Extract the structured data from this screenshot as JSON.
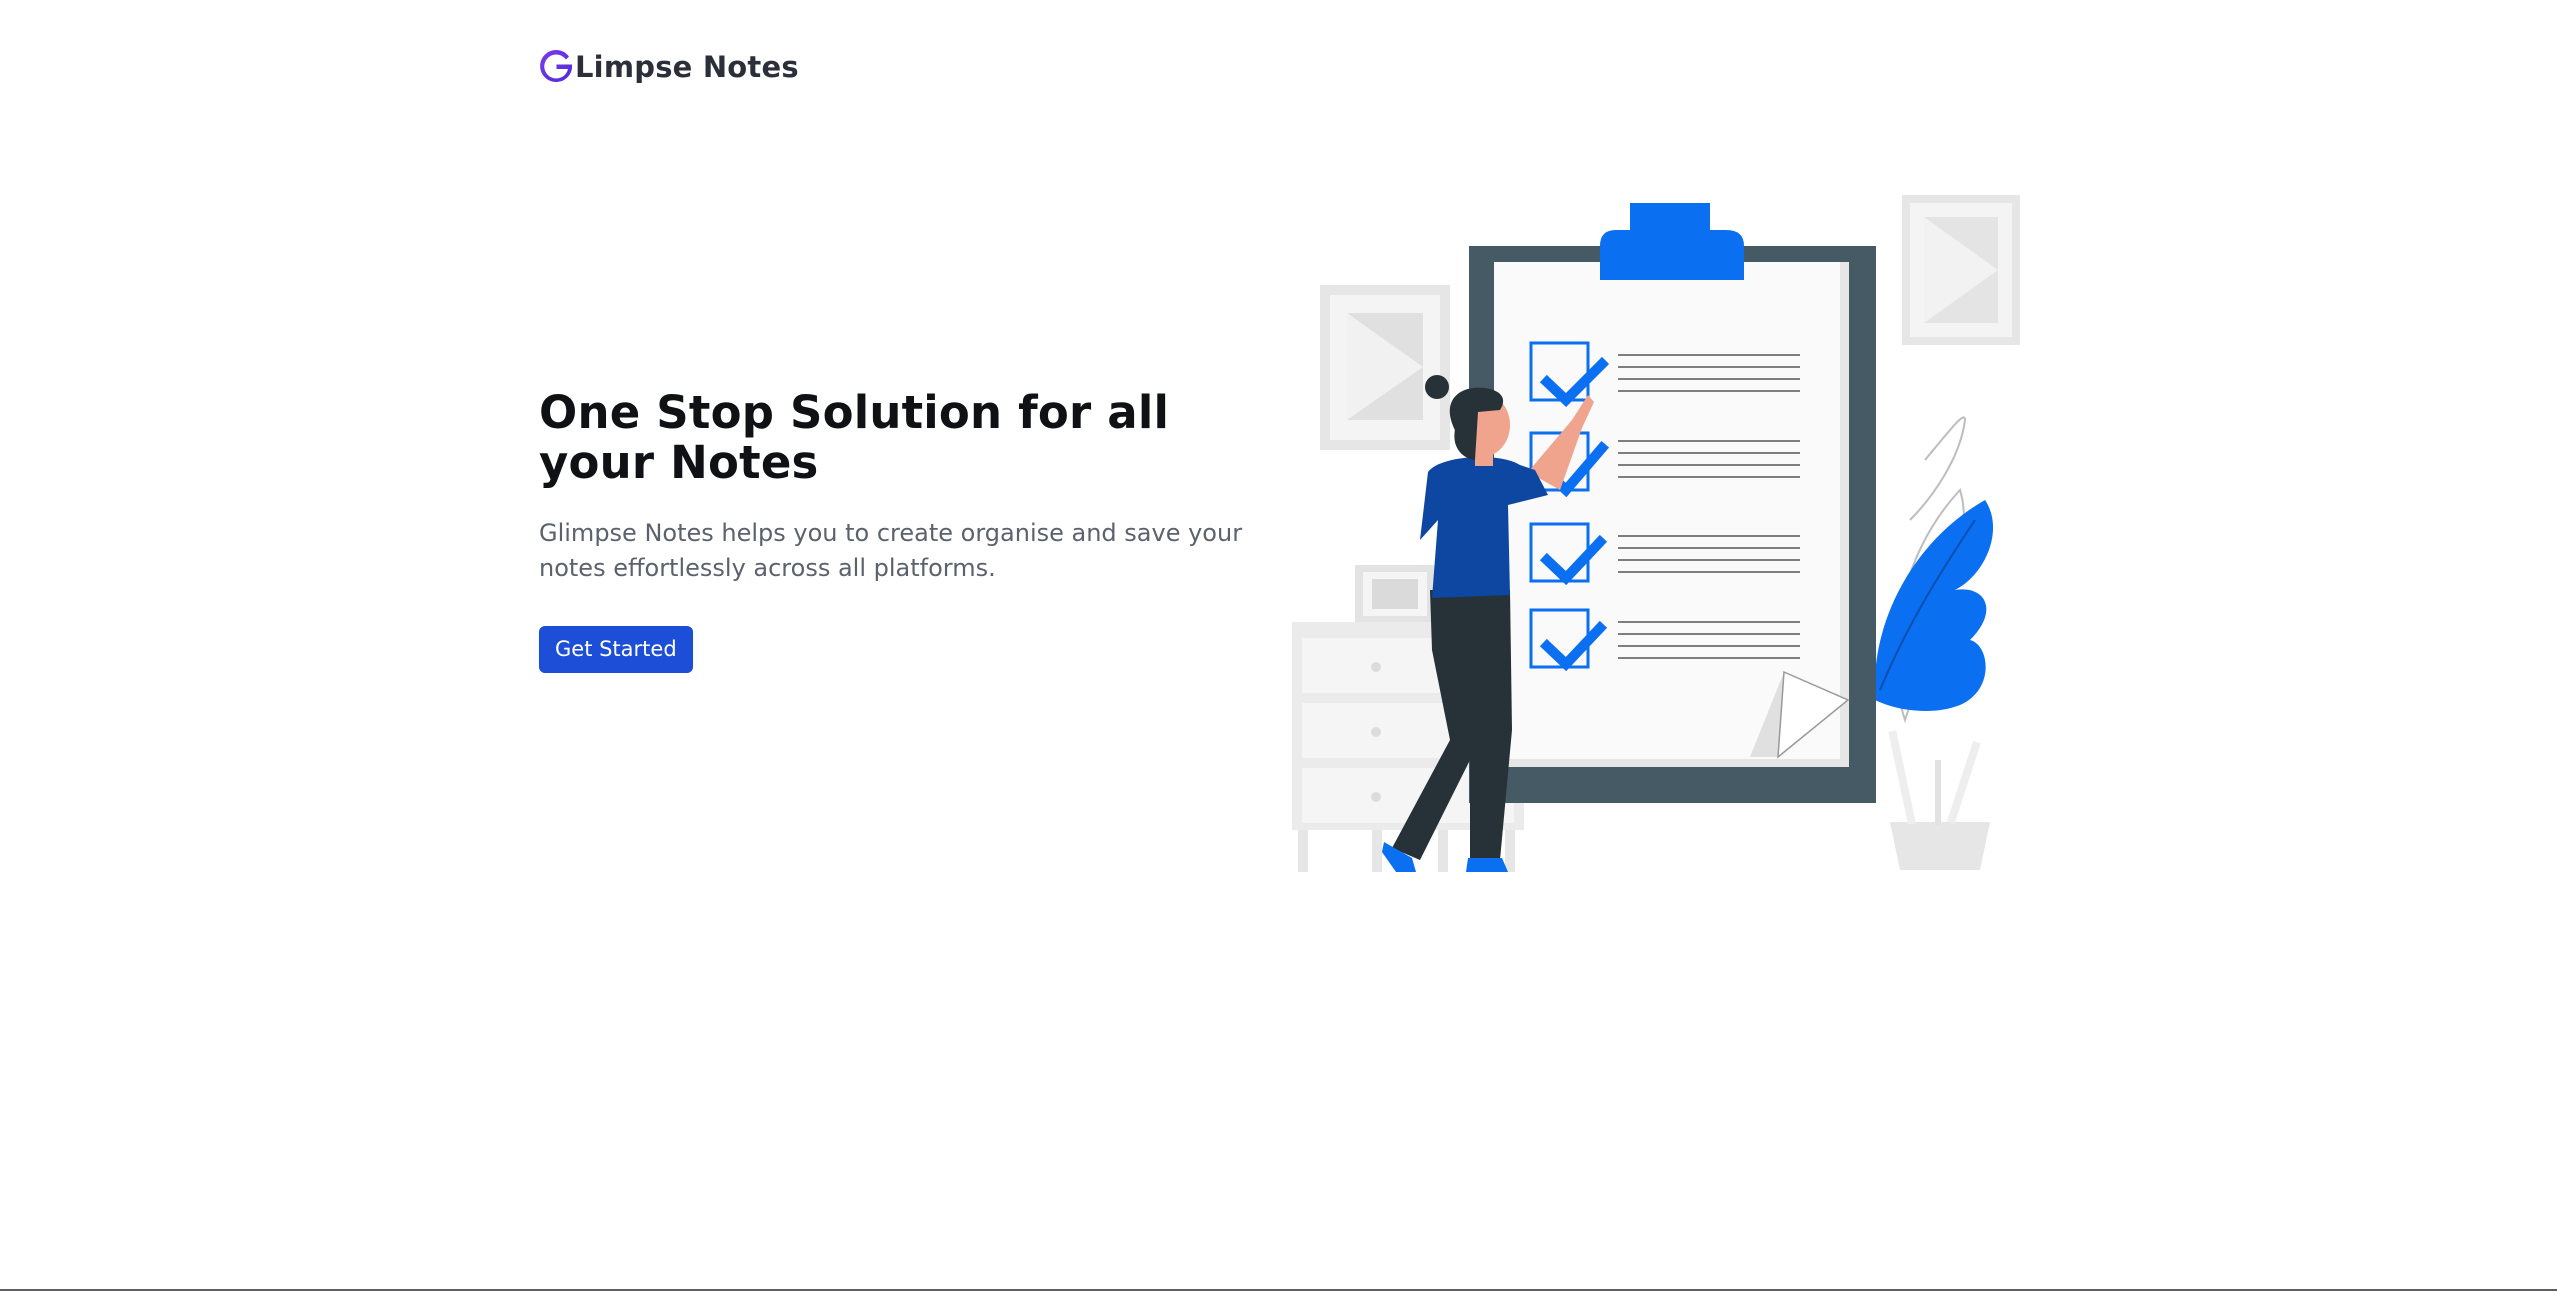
{
  "brand": {
    "logo_letter": "G",
    "name": "Limpse Notes",
    "logo_icon": "g-logo-icon"
  },
  "hero": {
    "title": "One Stop Solution for all your Notes",
    "description": "Glimpse Notes helps you to create organise and save your notes effortlessly across all platforms.",
    "cta_label": "Get Started"
  },
  "illustration": {
    "subject": "person-checking-checklist-illustration"
  },
  "colors": {
    "primary_blue": "#1d4ed8",
    "accent_blue": "#0a6ff0",
    "logo_purple": "#6d28d9",
    "text_dark": "#0f1114",
    "text_muted": "#5b626d",
    "clipboard_frame": "#455a64"
  }
}
